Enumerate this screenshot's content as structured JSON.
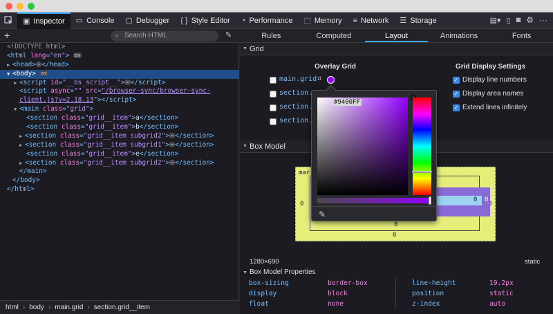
{
  "toolbar": {
    "tabs": [
      {
        "label": "Inspector",
        "icon": "inspector-icon",
        "active": true
      },
      {
        "label": "Console",
        "icon": "console-icon"
      },
      {
        "label": "Debugger",
        "icon": "debugger-icon"
      },
      {
        "label": "Style Editor",
        "icon": "style-editor-icon"
      },
      {
        "label": "Performance",
        "icon": "performance-icon"
      },
      {
        "label": "Memory",
        "icon": "memory-icon"
      },
      {
        "label": "Network",
        "icon": "network-icon"
      },
      {
        "label": "Storage",
        "icon": "storage-icon"
      }
    ]
  },
  "inspector": {
    "search_placeholder": "Search HTML",
    "tree": {
      "doctype": "<!DOCTYPE html>",
      "html_lang": "\"en\"",
      "script_id": "\"__bs_script__\"",
      "script_async": "\"\"",
      "script_src_1": "\"/browser-sync/browser-sync-",
      "script_src_2": "client.js?v=2.18.13",
      "main_class": "\"grid\"",
      "sections": [
        {
          "cls": "\"grid__item\"",
          "text": "a",
          "collapsed": false
        },
        {
          "cls": "\"grid__item\"",
          "text": "b",
          "collapsed": false
        },
        {
          "cls": "\"grid__item subgrid2\"",
          "text": "",
          "collapsed": true
        },
        {
          "cls": "\"grid__item subgrid1\"",
          "text": "",
          "collapsed": true
        },
        {
          "cls": "\"grid__item\"",
          "text": "e",
          "collapsed": false
        },
        {
          "cls": "\"grid__item subgrid2\"",
          "text": "",
          "collapsed": true
        }
      ]
    },
    "breadcrumbs": [
      "html",
      "body",
      "main.grid",
      "section.grid__item"
    ]
  },
  "sidebar": {
    "tabs": [
      "Rules",
      "Computed",
      "Layout",
      "Animations",
      "Fonts"
    ],
    "active_tab": "Layout",
    "grid_section": "Grid",
    "overlay_grid_title": "Overlay Grid",
    "grids": [
      "main.grid",
      "section.",
      "section.",
      "section."
    ],
    "display_settings_title": "Grid Display Settings",
    "settings": [
      "Display line numbers",
      "Display area names",
      "Extend lines infinitely"
    ],
    "box_model_section": "Box Model",
    "box_model": {
      "margin_label": "mar",
      "margin_left": "0",
      "margin_bottom": "0",
      "margin_right": "0",
      "border_right": "0",
      "padding_right": "0",
      "bottom_inner": "0",
      "size": "1280×690",
      "position": "static"
    },
    "properties_section": "Box Model Properties",
    "properties": [
      {
        "name": "box-sizing",
        "value": "border-box"
      },
      {
        "name": "display",
        "value": "block"
      },
      {
        "name": "float",
        "value": "none"
      },
      {
        "name": "line-height",
        "value": "19.2px"
      },
      {
        "name": "position",
        "value": "static"
      },
      {
        "name": "z-index",
        "value": "auto"
      }
    ]
  },
  "color_picker": {
    "hex": "#9400FF",
    "color": "#9400ff"
  }
}
